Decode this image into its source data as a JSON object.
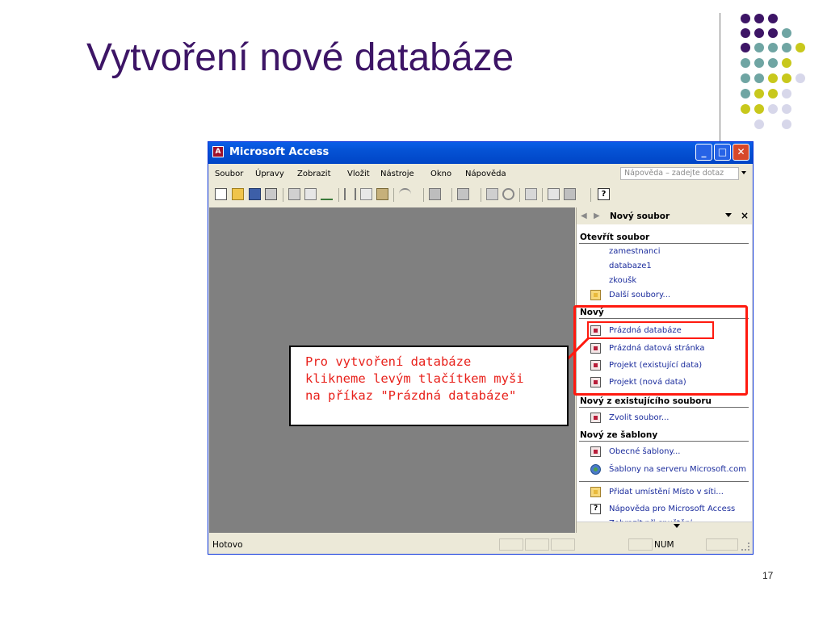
{
  "slide": {
    "title": "Vytvoření nové databáze",
    "page_number": "17",
    "decor_colors": {
      "purple": "#3d1566",
      "teal": "#6fa5a3",
      "yellow": "#c8c81c",
      "lavender": "#d7d7ea"
    }
  },
  "window": {
    "title": "Microsoft Access",
    "icon": "access-key-icon",
    "buttons": {
      "minimize": "_",
      "maximize": "□",
      "close": "✕"
    },
    "menu": [
      "Soubor",
      "Úpravy",
      "Zobrazit",
      "Vložit",
      "Nástroje",
      "Okno",
      "Nápověda"
    ],
    "help_placeholder": "Nápověda – zadejte dotaz",
    "toolbar_icons": [
      "new-icon",
      "open-icon",
      "save-icon",
      "search-icon",
      "print-icon",
      "print-preview-icon",
      "spelling-icon",
      "cut-icon",
      "copy-icon",
      "paste-icon",
      "undo-icon",
      "analyze-icon",
      "office-links-icon",
      "code-icon",
      "properties-icon",
      "relationships-icon",
      "new-object-icon",
      "help-icon"
    ]
  },
  "task_pane": {
    "title": "Nový soubor",
    "close": "×",
    "sections": {
      "open": {
        "heading": "Otevřít soubor",
        "recent": [
          "zamestnanci",
          "databaze1",
          "zkoušk"
        ],
        "more": "Další soubory..."
      },
      "new": {
        "heading": "Nový",
        "items": [
          "Prázdná databáze",
          "Prázdná datová stránka",
          "Projekt (existující data)",
          "Projekt (nová data)"
        ]
      },
      "from_existing": {
        "heading": "Nový z existujícího souboru",
        "items": [
          "Zvolit soubor..."
        ]
      },
      "templates": {
        "heading": "Nový ze šablony",
        "items": [
          "Obecné šablony...",
          "Šablony na serveru Microsoft.com"
        ]
      },
      "other": {
        "items": [
          "Přidat umístění Místo v síti...",
          "Nápověda pro Microsoft Access",
          "Zobrazit při spuštění"
        ]
      }
    }
  },
  "status": {
    "text": "Hotovo",
    "num": "NUM"
  },
  "callout": {
    "lines": [
      "Pro vytvoření databáze",
      "klikneme levým tlačítkem myši",
      "na příkaz \"Prázdná databáze\""
    ],
    "color": "#e8211b"
  }
}
